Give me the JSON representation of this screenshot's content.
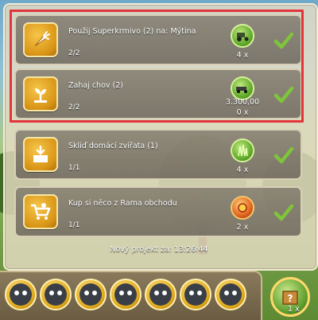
{
  "tasks": [
    {
      "title": "Použij Superkrmivo (2) na: Mýtina",
      "progress": "2/2",
      "reward": "4 x",
      "icon": "carrot-icon",
      "reward_icon": "tractor-reward-icon"
    },
    {
      "title": "Zahaj chov (2)",
      "progress": "2/2",
      "reward_value": "3.300,00",
      "reward": "0 x",
      "icon": "sprout-icon",
      "reward_icon": "coin-reward-icon"
    },
    {
      "title": "Skliď domácí zvířata (1)",
      "progress": "1/1",
      "reward": "4 x",
      "icon": "harvest-box-icon",
      "reward_icon": "grass-reward-icon"
    },
    {
      "title": "Kup si něco z Rama obchodu",
      "progress": "1/1",
      "reward": "2 x",
      "icon": "shopping-cart-icon",
      "reward_icon": "fire-reward-icon"
    }
  ],
  "footer": {
    "timer": "Nový projekt za: 13:26:44"
  },
  "bottom": {
    "big_reward_count": "1 x"
  },
  "colors": {
    "highlight": "#e3343a",
    "check": "#7fc53a",
    "icon_bg": "#e5a324"
  }
}
